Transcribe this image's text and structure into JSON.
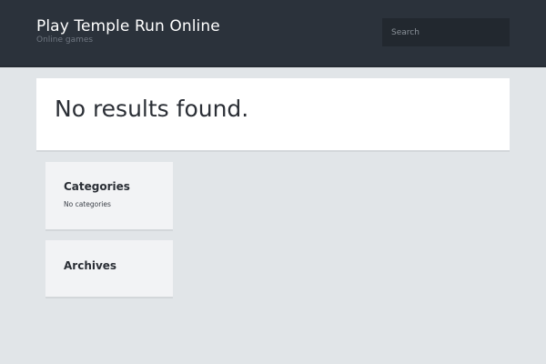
{
  "header": {
    "site_title": "Play Temple Run Online",
    "site_description": "Online games",
    "search_placeholder": "Search"
  },
  "main": {
    "title": "No results found."
  },
  "sidebar": {
    "categories": {
      "title": "Categories",
      "empty_text": "No categories"
    },
    "archives": {
      "title": "Archives"
    }
  },
  "colors": {
    "header_bg": "#2b323b",
    "page_bg": "#e1e5e8",
    "search_bg": "#22282f"
  }
}
